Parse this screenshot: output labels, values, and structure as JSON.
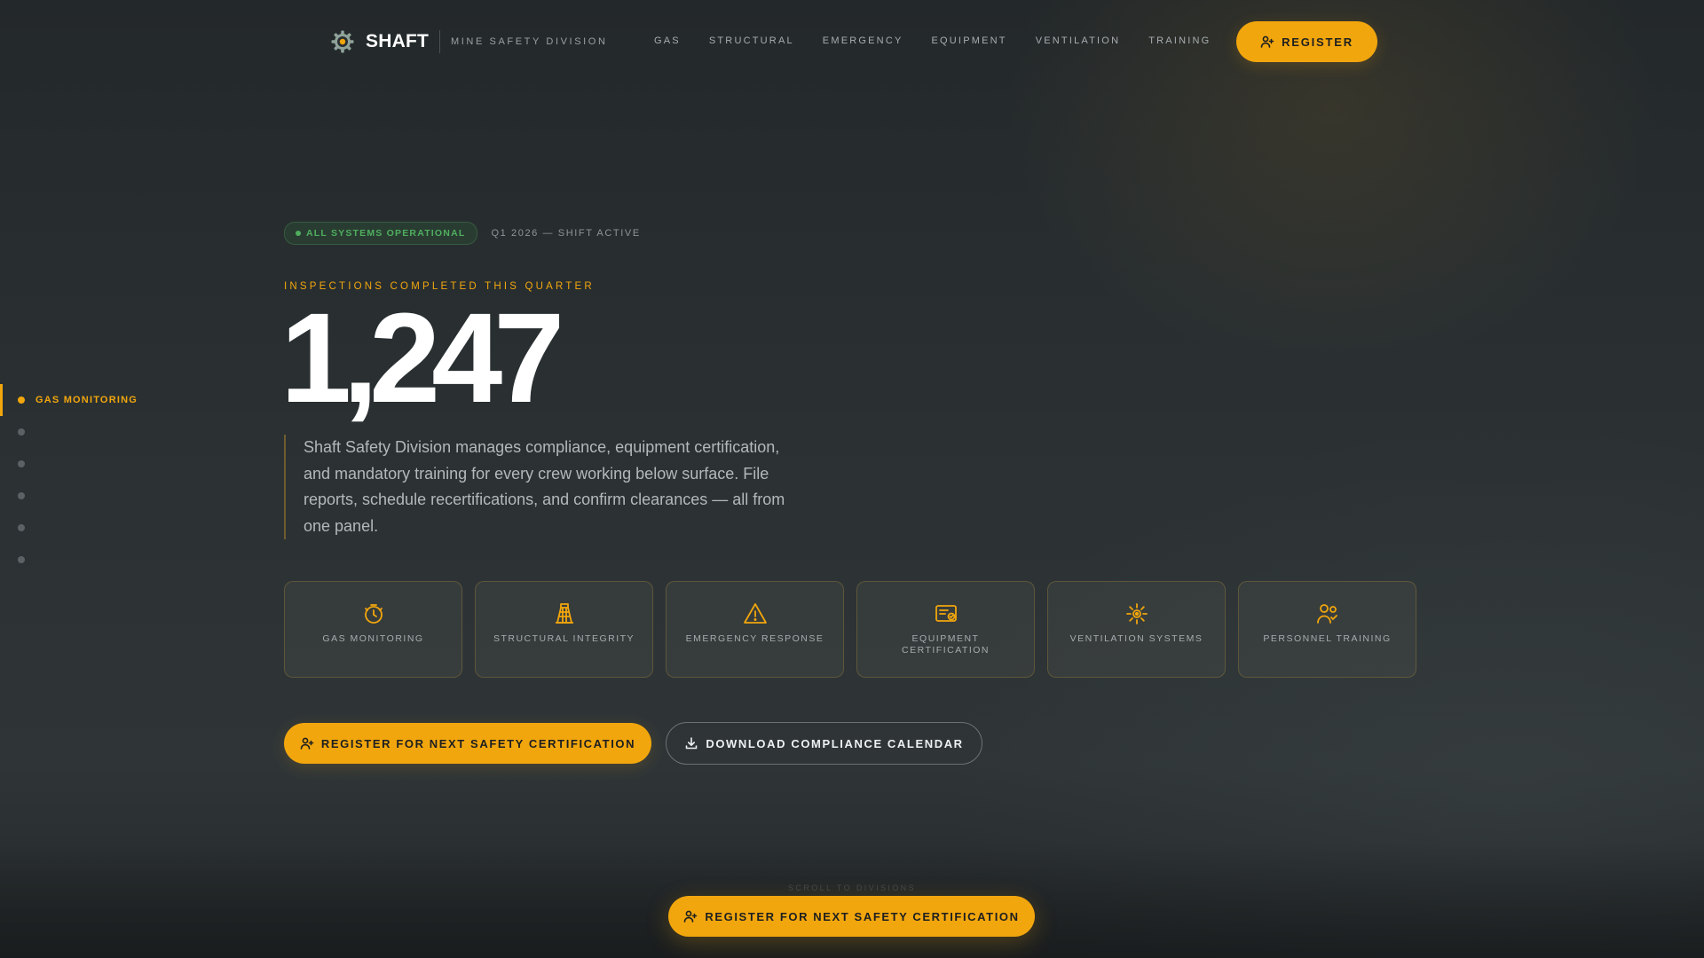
{
  "nav": {
    "brand_name": "SHAFT",
    "brand_sub": "MINE SAFETY DIVISION",
    "links": [
      "GAS",
      "STRUCTURAL",
      "EMERGENCY",
      "EQUIPMENT",
      "VENTILATION",
      "TRAINING"
    ],
    "register_label": "REGISTER"
  },
  "side_index": {
    "active_label": "GAS MONITORING",
    "dot_count": 6
  },
  "hero": {
    "status_badge": "ALL SYSTEMS OPERATIONAL",
    "quarter_label": "Q1 2026 — SHIFT ACTIVE",
    "eyebrow": "INSPECTIONS COMPLETED THIS QUARTER",
    "big_number": "1,247",
    "intro": "Shaft Safety Division manages compliance, equipment certification, and mandatory training for every crew working below surface. File reports, schedule recertifications, and confirm clearances — all from one panel."
  },
  "cards": [
    {
      "label": "GAS MONITORING",
      "icon": "gauge-icon"
    },
    {
      "label": "STRUCTURAL INTEGRITY",
      "icon": "beam-structure-icon"
    },
    {
      "label": "EMERGENCY RESPONSE",
      "icon": "warning-triangle-icon"
    },
    {
      "label": "EQUIPMENT CERTIFICATION",
      "icon": "certificate-icon"
    },
    {
      "label": "VENTILATION SYSTEMS",
      "icon": "sun-fan-icon"
    },
    {
      "label": "PERSONNEL TRAINING",
      "icon": "people-check-icon"
    }
  ],
  "cta": {
    "primary": "REGISTER FOR NEXT SAFETY CERTIFICATION",
    "secondary": "DOWNLOAD COMPLIANCE CALENDAR"
  },
  "bottom": {
    "scroll_hint": "SCROLL TO DIVISIONS",
    "sticky_cta": "REGISTER FOR NEXT SAFETY CERTIFICATION"
  },
  "colors": {
    "accent": "#f2a60d",
    "status_green": "#4fae5e",
    "background": "#2b3133"
  }
}
